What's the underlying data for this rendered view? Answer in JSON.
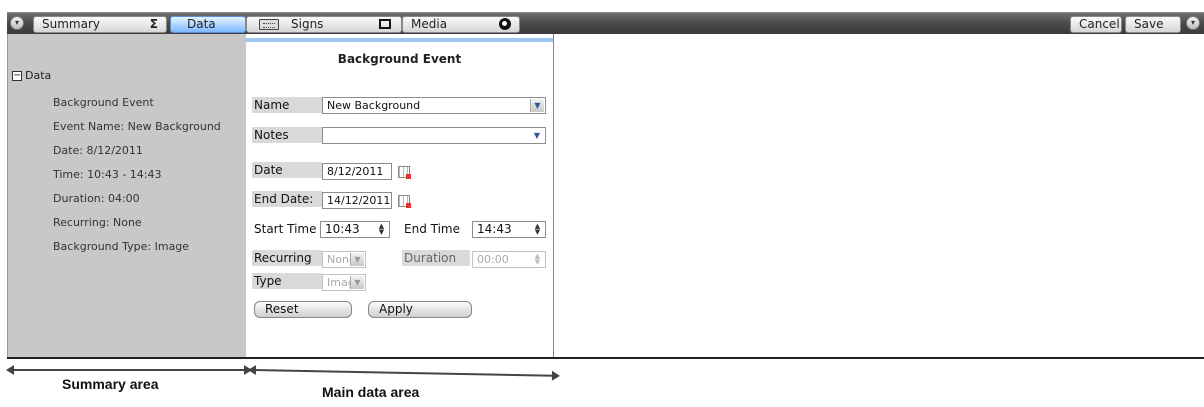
{
  "toolbar": {
    "tabs": [
      {
        "label": "Summary",
        "icon": "Σ"
      },
      {
        "label": "Data"
      },
      {
        "label": "Signs"
      },
      {
        "label": "Media"
      }
    ],
    "cancel_label": "Cancel",
    "save_label": "Save"
  },
  "summary": {
    "root_label": "Data",
    "lines": [
      "Background Event",
      "Event Name: New Background",
      "Date: 8/12/2011",
      "Time: 10:43 - 14:43",
      "Duration: 04:00",
      "Recurring: None",
      "Background Type: Image"
    ]
  },
  "form": {
    "title": "Background Event",
    "name_label": "Name",
    "name_value": "New Background",
    "notes_label": "Notes",
    "notes_value": "",
    "date_label": "Date",
    "date_value": "8/12/2011",
    "end_date_label": "End Date:",
    "end_date_value": "14/12/2011",
    "start_time_label": "Start Time",
    "start_time_value": "10:43",
    "end_time_label": "End Time",
    "end_time_value": "14:43",
    "recurring_label": "Recurring",
    "recurring_value": "None",
    "duration_label": "Duration",
    "duration_value": "00:00",
    "type_label": "Type",
    "type_value": "Image",
    "reset_label": "Reset",
    "apply_label": "Apply"
  },
  "annotations": {
    "summary_area": "Summary area",
    "main_data_area": "Main data area"
  },
  "colors": {
    "active_tab": "#7bb8ff",
    "summary_bg": "#c8c8c8",
    "accent_bar": "#9fc6ee"
  }
}
